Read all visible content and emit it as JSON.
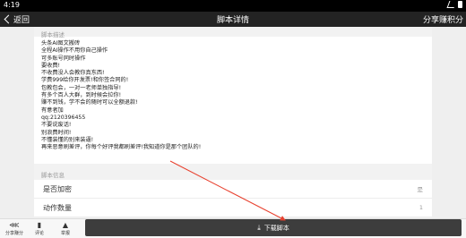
{
  "status_bar": {
    "time": "4:19"
  },
  "header": {
    "back_label": "返回",
    "title": "脚本详情",
    "share_label": "分享赚积分"
  },
  "description": {
    "section_label": "脚本描述",
    "lines": [
      "头条AI图文搬砖",
      "全程AI操作不用你自己操作",
      "可多账号同时操作",
      "要收费!",
      "不收费没人会教你真东西!",
      "学费999给你开发票!和你签合同的!",
      "包教包会，一对一老师单独指导!",
      "有多个百人大群，到时候会拉你!",
      "赚不到钱，学不会的随时可以全额退款!",
      "有意者加",
      "qq:2120396455",
      "不要说废话!",
      "别浪费时间!",
      "不懂装懂的别来装逼!",
      "再来恶意刷差评，你每个好评我都刷差评!我知道你是那个团队的!"
    ]
  },
  "info": {
    "section_label": "脚本信息",
    "rows": [
      {
        "label": "是否加密",
        "value": "是"
      },
      {
        "label": "动作数量",
        "value": "1"
      }
    ]
  },
  "bottom": {
    "share_label": "分享赚分",
    "comment_label": "评论",
    "report_label": "举报",
    "download_label": "下载脚本"
  },
  "colors": {
    "topbar": "#232323",
    "download_button": "#3d3d3d",
    "arrow": "#e8402e"
  }
}
